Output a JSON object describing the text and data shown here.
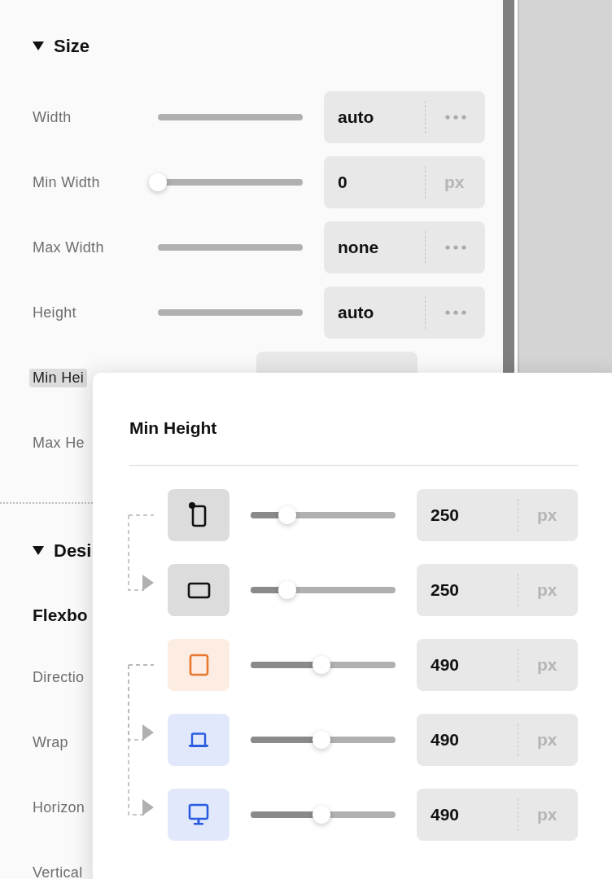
{
  "size_section": {
    "title": "Size",
    "expanded": true,
    "rows": [
      {
        "label": "Width",
        "kind": "track",
        "value": "auto",
        "unit": {
          "kind": "menu"
        },
        "highlighted": false
      },
      {
        "label": "Min Width",
        "kind": "slider",
        "level": 0,
        "value": "0",
        "unit": {
          "kind": "text",
          "text": "px"
        },
        "highlighted": false
      },
      {
        "label": "Max Width",
        "kind": "track",
        "value": "none",
        "unit": {
          "kind": "menu"
        },
        "highlighted": false
      },
      {
        "label": "Height",
        "kind": "track",
        "value": "auto",
        "unit": {
          "kind": "menu"
        },
        "highlighted": false
      },
      {
        "label": "Min Hei",
        "kind": "covered",
        "highlighted": true
      },
      {
        "label": "Max He",
        "kind": "covered_label",
        "highlighted": false
      }
    ]
  },
  "design_section": {
    "title": "Desi",
    "expanded": true,
    "subtitle": "Flexbo",
    "rows": [
      {
        "label": "Directio"
      },
      {
        "label": "Wrap"
      },
      {
        "label": "Horizon"
      },
      {
        "label": "Vertical"
      }
    ]
  },
  "popover": {
    "title": "Min Height",
    "rows": [
      {
        "kind": "phone-portrait",
        "color": "#111111",
        "inherits": false,
        "level": 0.25,
        "value": "250",
        "unit": "px"
      },
      {
        "kind": "phone-landscape",
        "color": "#111111",
        "inherits": true,
        "level": 0.25,
        "value": "250",
        "unit": "px"
      },
      {
        "kind": "tablet",
        "color": "#e8782f",
        "inherits": false,
        "level": 0.49,
        "value": "490",
        "unit": "px"
      },
      {
        "kind": "laptop",
        "color": "#2a5ce0",
        "inherits": true,
        "level": 0.49,
        "value": "490",
        "unit": "px"
      },
      {
        "kind": "desktop",
        "color": "#2a5ce0",
        "inherits": true,
        "level": 0.49,
        "value": "490",
        "unit": "px"
      }
    ]
  }
}
